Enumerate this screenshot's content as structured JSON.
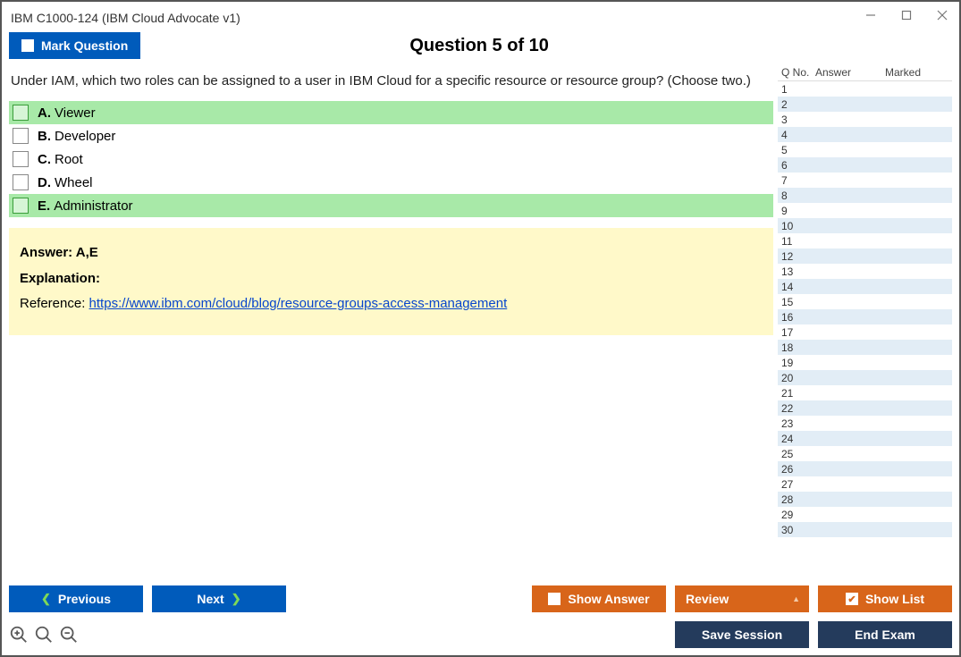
{
  "window": {
    "title": "IBM C1000-124 (IBM Cloud Advocate v1)"
  },
  "header": {
    "mark_label": "Mark Question",
    "question_label": "Question 5 of 10"
  },
  "question": {
    "prompt": "Under IAM, which two roles can be assigned to a user in IBM Cloud for a specific resource or resource group? (Choose two.)",
    "options": [
      {
        "letter": "A.",
        "text": "Viewer",
        "correct": true
      },
      {
        "letter": "B.",
        "text": "Developer",
        "correct": false
      },
      {
        "letter": "C.",
        "text": "Root",
        "correct": false
      },
      {
        "letter": "D.",
        "text": "Wheel",
        "correct": false
      },
      {
        "letter": "E.",
        "text": "Administrator",
        "correct": true
      }
    ]
  },
  "answer_panel": {
    "answer_label": "Answer: A,E",
    "explanation_label": "Explanation:",
    "reference_prefix": "Reference: ",
    "reference_link": "https://www.ibm.com/cloud/blog/resource-groups-access-management"
  },
  "side": {
    "col_qno": "Q No.",
    "col_answer": "Answer",
    "col_marked": "Marked",
    "row_count": 30
  },
  "buttons": {
    "previous": "Previous",
    "next": "Next",
    "show_answer": "Show Answer",
    "review": "Review",
    "show_list": "Show List",
    "save_session": "Save Session",
    "end_exam": "End Exam"
  }
}
